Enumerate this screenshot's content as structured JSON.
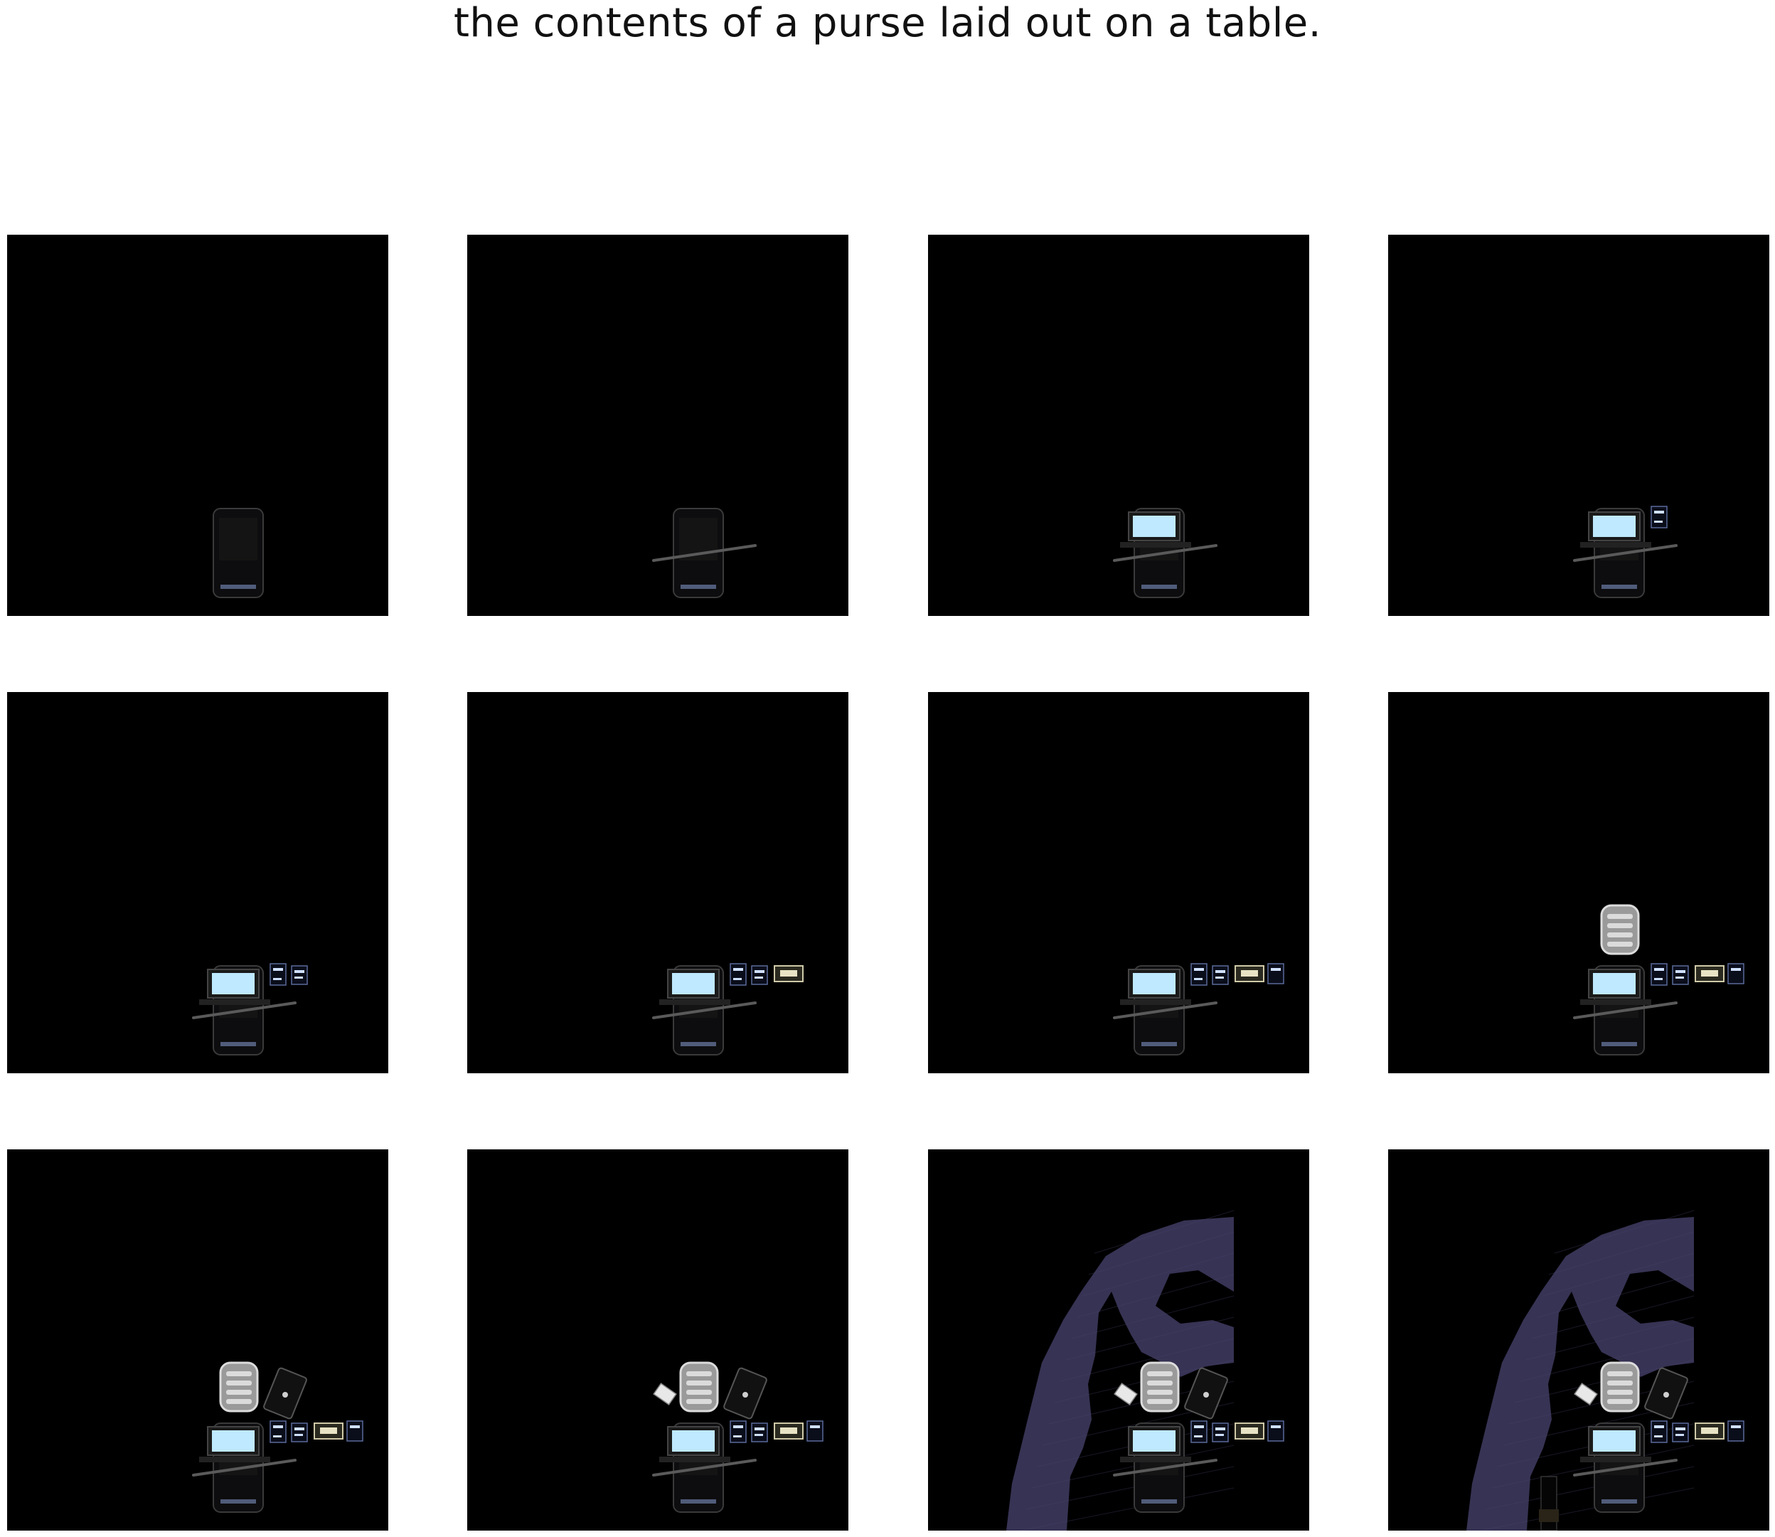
{
  "title": "the contents of a purse laid out on a table.",
  "panels": [
    {
      "step": 1,
      "objects": [
        "phone"
      ]
    },
    {
      "step": 2,
      "objects": [
        "phone",
        "pen"
      ]
    },
    {
      "step": 3,
      "objects": [
        "phone",
        "pen",
        "screen"
      ]
    },
    {
      "step": 4,
      "objects": [
        "phone",
        "pen",
        "screen",
        "card1"
      ]
    },
    {
      "step": 5,
      "objects": [
        "phone",
        "pen",
        "screen",
        "card1",
        "card2"
      ]
    },
    {
      "step": 6,
      "objects": [
        "phone",
        "pen",
        "screen",
        "card1",
        "card2",
        "card3"
      ]
    },
    {
      "step": 7,
      "objects": [
        "phone",
        "pen",
        "screen",
        "card1",
        "card2",
        "card3",
        "card4"
      ]
    },
    {
      "step": 8,
      "objects": [
        "phone",
        "pen",
        "screen",
        "card1",
        "card2",
        "card3",
        "card4",
        "keypad"
      ]
    },
    {
      "step": 9,
      "objects": [
        "phone",
        "pen",
        "screen",
        "card1",
        "card2",
        "card3",
        "card4",
        "keypad",
        "wallet"
      ]
    },
    {
      "step": 10,
      "objects": [
        "phone",
        "pen",
        "screen",
        "card1",
        "card2",
        "card3",
        "card4",
        "keypad",
        "wallet",
        "tissue"
      ]
    },
    {
      "step": 11,
      "objects": [
        "phone",
        "pen",
        "screen",
        "card1",
        "card2",
        "card3",
        "card4",
        "keypad",
        "wallet",
        "tissue",
        "cloth"
      ]
    },
    {
      "step": 12,
      "objects": [
        "phone",
        "pen",
        "screen",
        "card1",
        "card2",
        "card3",
        "card4",
        "keypad",
        "wallet",
        "tissue",
        "cloth",
        "bottle"
      ]
    }
  ],
  "colors": {
    "panel_bg": "#000000",
    "cloth": "#3a3658",
    "screen": "#bfe9ff"
  }
}
